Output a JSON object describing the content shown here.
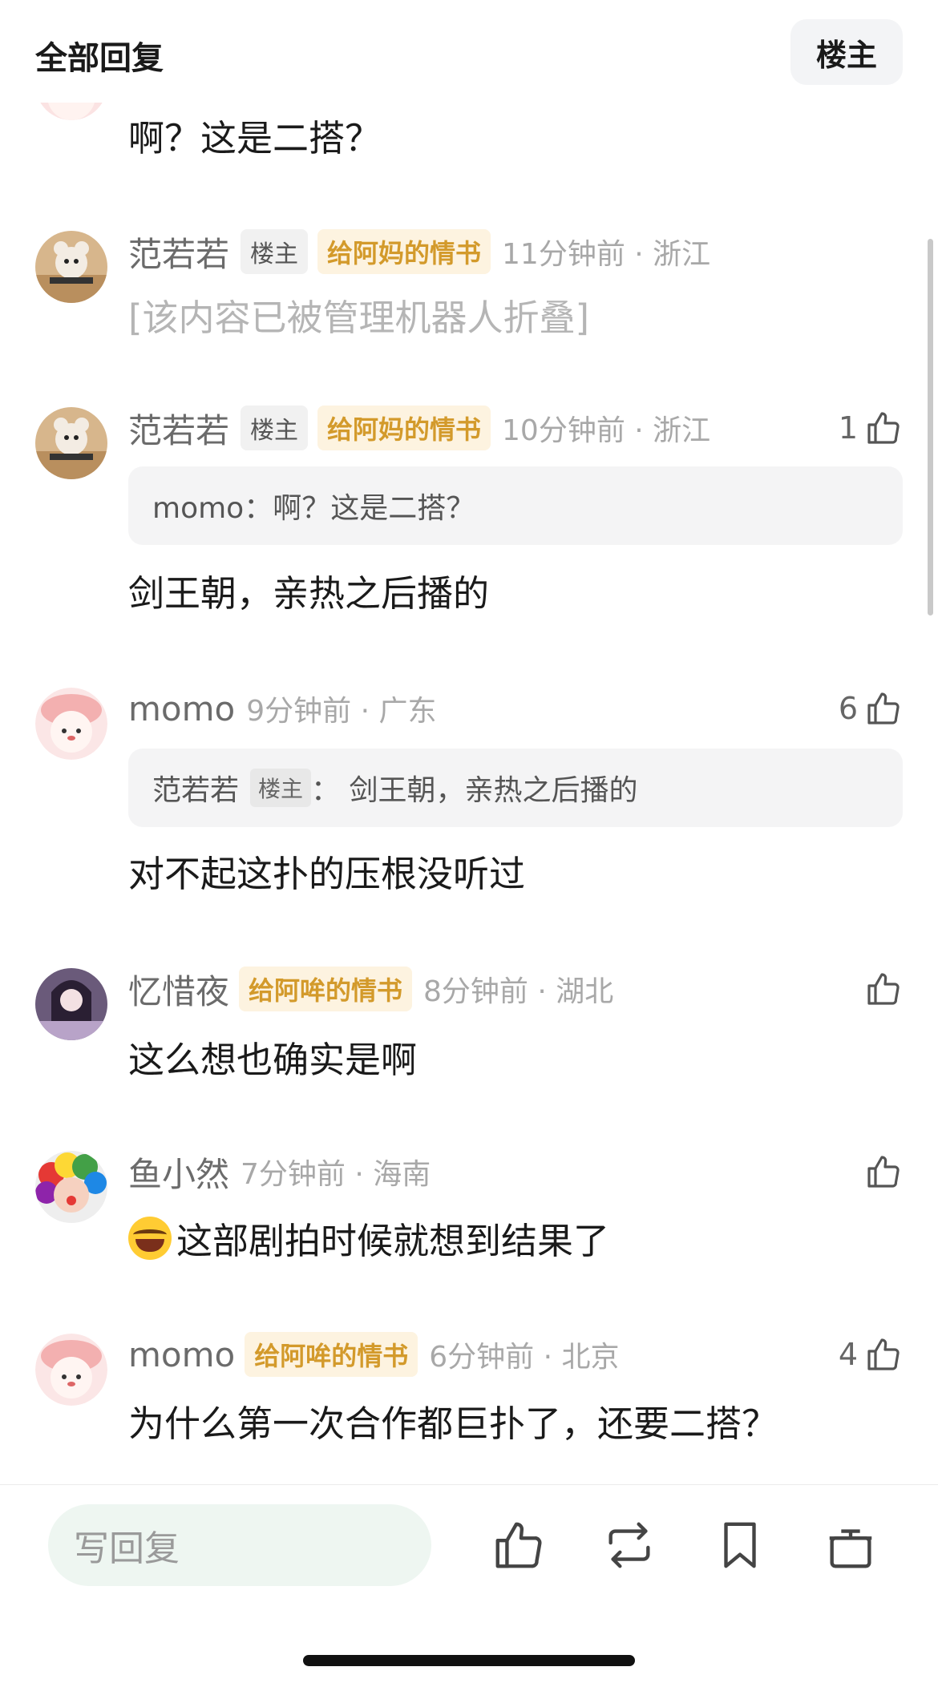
{
  "header": {
    "title": "全部回复",
    "host_button": "楼主"
  },
  "comments": [
    {
      "content": "啊？这是二搭？"
    },
    {
      "name": "范若若",
      "host_badge": "楼主",
      "tag": "给阿妈的情书",
      "time": "11分钟前 · 浙江",
      "content": "[该内容已被管理机器人折叠]"
    },
    {
      "name": "范若若",
      "host_badge": "楼主",
      "tag": "给阿妈的情书",
      "time": "10分钟前 · 浙江",
      "likes": "1",
      "quote": "momo：啊？这是二搭？",
      "content": "剑王朝，亲热之后播的"
    },
    {
      "name": "momo",
      "time": "9分钟前 · 广东",
      "likes": "6",
      "quote_name": "范若若",
      "quote_host": "楼主",
      "quote_text": "：  剑王朝，亲热之后播的",
      "content": "对不起这扑的压根没听过"
    },
    {
      "name": "忆惜夜",
      "tag": "给阿哞的情书",
      "time": "8分钟前 · 湖北",
      "content": "这么想也确实是啊"
    },
    {
      "name": "鱼小然",
      "time": "7分钟前 · 海南",
      "content": "这部剧拍时候就想到结果了"
    },
    {
      "name": "momo",
      "tag": "给阿哞的情书",
      "time": "6分钟前 · 北京",
      "likes": "4",
      "content": "为什么第一次合作都巨扑了，还要二搭？"
    }
  ],
  "bottom_bar": {
    "reply_placeholder": "写回复"
  },
  "icons": [
    "thumbs-up-icon",
    "repost-icon",
    "bookmark-icon",
    "gift-icon"
  ]
}
